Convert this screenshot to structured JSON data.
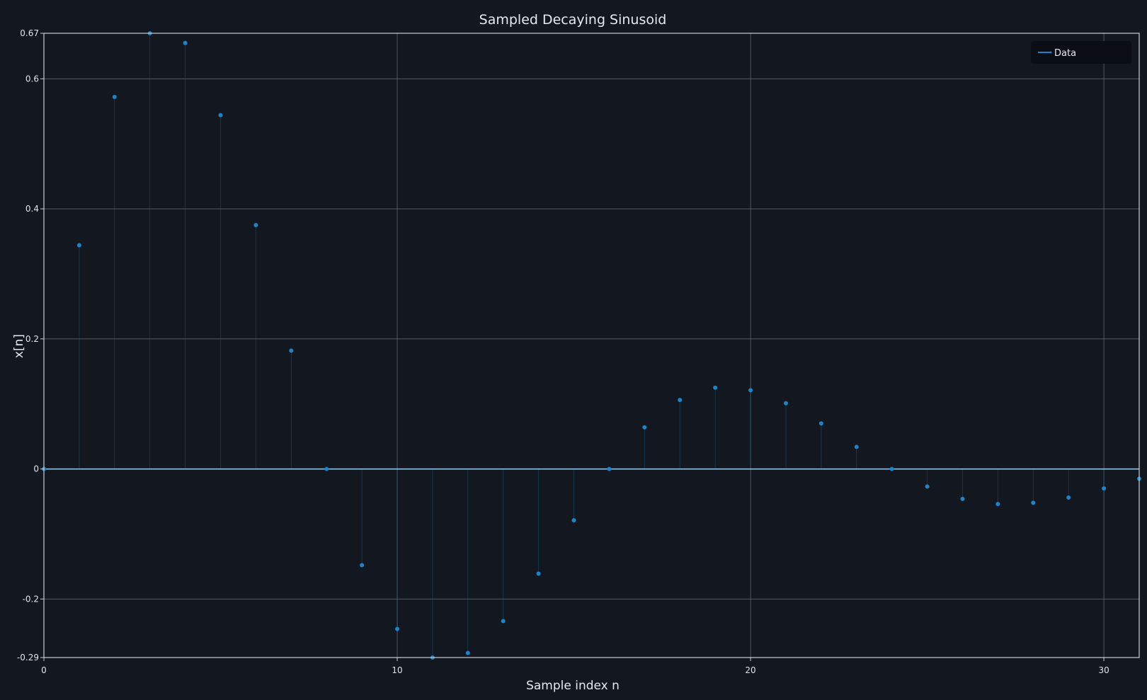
{
  "chart_data": {
    "type": "stem",
    "title": "Sampled Decaying Sinusoid",
    "xlabel": "Sample index n",
    "ylabel": "x[n]",
    "xlim": [
      0,
      31
    ],
    "ylim": [
      -0.29,
      0.67
    ],
    "x_ticks": [
      0,
      10,
      20,
      30
    ],
    "x_tick_labels": [
      "0",
      "10",
      "20",
      "30"
    ],
    "y_ticks": [
      -0.29,
      -0.2,
      0,
      0.2,
      0.4,
      0.6,
      0.67
    ],
    "y_tick_labels": [
      "-0.29",
      "-0.2",
      "0",
      "0.2",
      "0.4",
      "0.6",
      "0.67"
    ],
    "grid": true,
    "legend": {
      "position": "top-right",
      "entries": [
        "Data"
      ]
    },
    "series": [
      {
        "name": "Data",
        "color": "#1f83c7",
        "x": [
          0,
          1,
          2,
          3,
          4,
          5,
          6,
          7,
          8,
          9,
          10,
          11,
          12,
          13,
          14,
          15,
          16,
          17,
          18,
          19,
          20,
          21,
          22,
          23,
          24,
          25,
          26,
          27,
          28,
          29,
          30,
          31
        ],
        "values": [
          0,
          0.344,
          0.572,
          0.67,
          0.655,
          0.544,
          0.375,
          0.182,
          0,
          -0.148,
          -0.246,
          -0.29,
          -0.283,
          -0.234,
          -0.161,
          -0.079,
          0,
          0.064,
          0.106,
          0.125,
          0.121,
          0.101,
          0.07,
          0.034,
          0,
          -0.027,
          -0.046,
          -0.054,
          -0.052,
          -0.044,
          -0.03,
          -0.015
        ]
      }
    ]
  },
  "colors": {
    "background": "#131820",
    "grid": "#5d6470",
    "axis": "#c9ced6",
    "baseline": "#9ecbee",
    "marker": "#1f83c7",
    "legend_bg": "#0b0f15"
  }
}
